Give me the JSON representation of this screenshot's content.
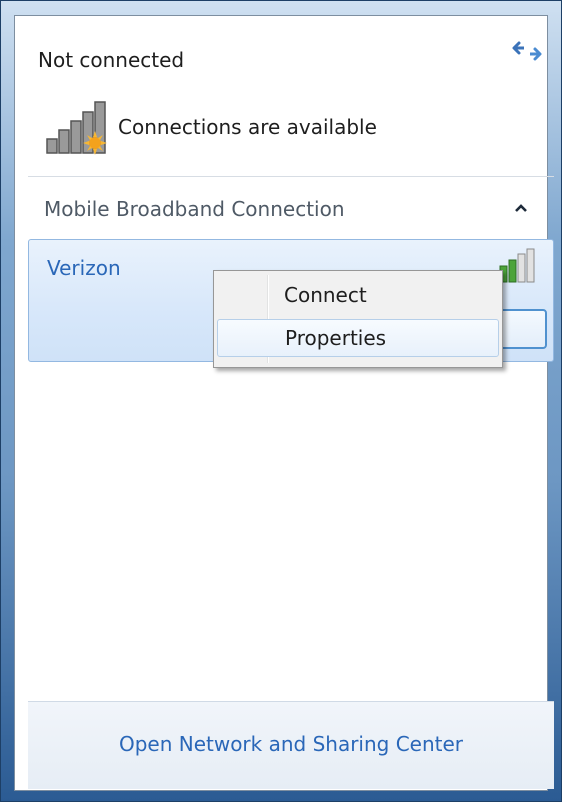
{
  "status": {
    "title": "Not connected",
    "subtitle": "Connections are available",
    "refresh_icon": "refresh-arrows-icon",
    "signal_icon": "signal-bars-with-sunburst-icon"
  },
  "section": {
    "title": "Mobile Broadband Connection",
    "collapse_icon": "chevron-up-icon",
    "items": [
      {
        "name": "Verizon",
        "signal_icon": "signal-bars-icon",
        "button_label": "Connect"
      }
    ]
  },
  "context_menu": {
    "items": [
      {
        "label": "Connect"
      },
      {
        "label": "Properties"
      }
    ],
    "highlighted_index": 1
  },
  "footer": {
    "link_label": "Open Network and Sharing Center"
  },
  "colors": {
    "accent_text": "#2a67b8",
    "selection_background": "#d7e7fa",
    "signal_green": "#4ca43a",
    "warning_sun": "#f4a21c"
  }
}
